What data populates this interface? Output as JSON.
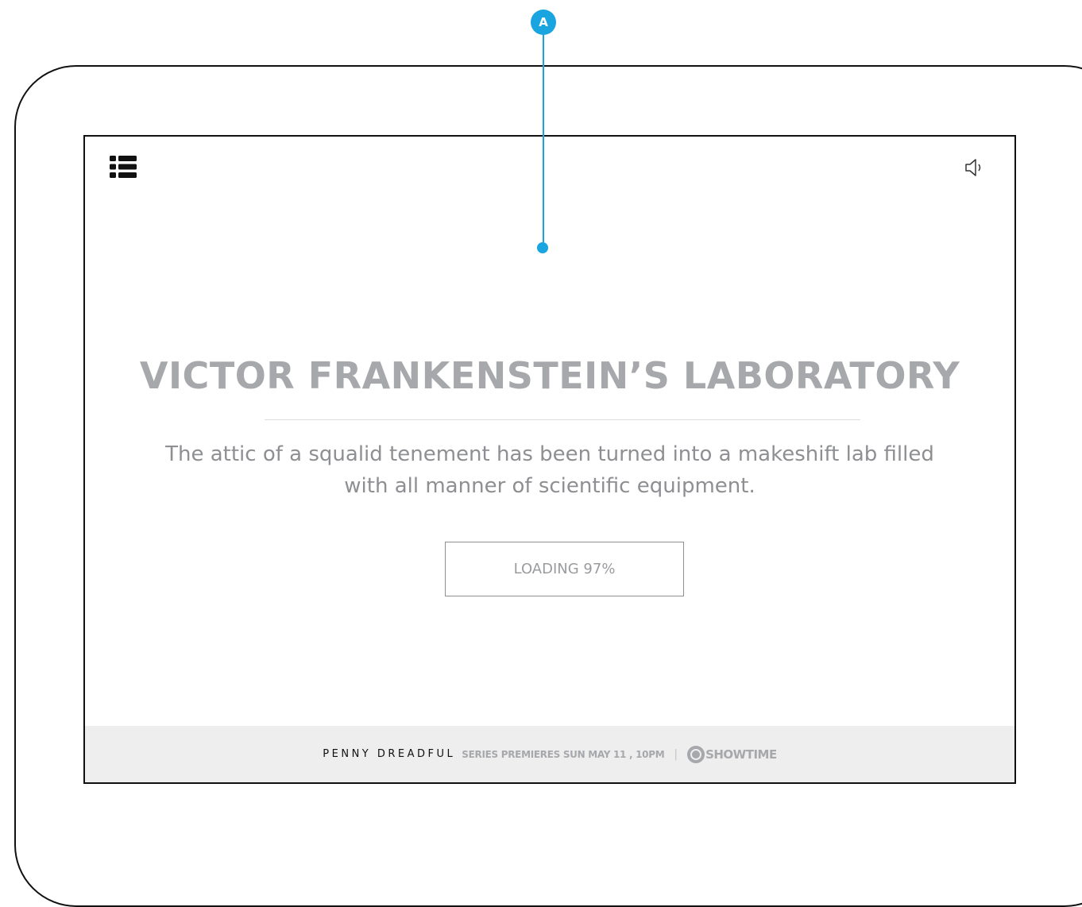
{
  "annotation": {
    "marker": "A",
    "color": "#1aa5e0"
  },
  "toolbar": {
    "menu_icon": "list-menu-icon",
    "sound_icon": "speaker-icon"
  },
  "main": {
    "title": "VICTOR FRANKENSTEIN’S LABORATORY",
    "description": "The attic of a squalid tenement has been turned into a makeshift lab filled with all manner of scientific equipment.",
    "loading_label": "LOADING 97%",
    "loading_progress_percent": 97
  },
  "footer": {
    "show_name": "PENNY DREADFUL",
    "premiere": "SERIES PREMIERES SUN MAY 11 , 10PM",
    "separator": "|",
    "network": "SHOWTIME"
  },
  "colors": {
    "title": "#a7a8ab",
    "body_text": "#8e8f92",
    "footer_bg": "#eeeeee",
    "frame": "#111111"
  }
}
